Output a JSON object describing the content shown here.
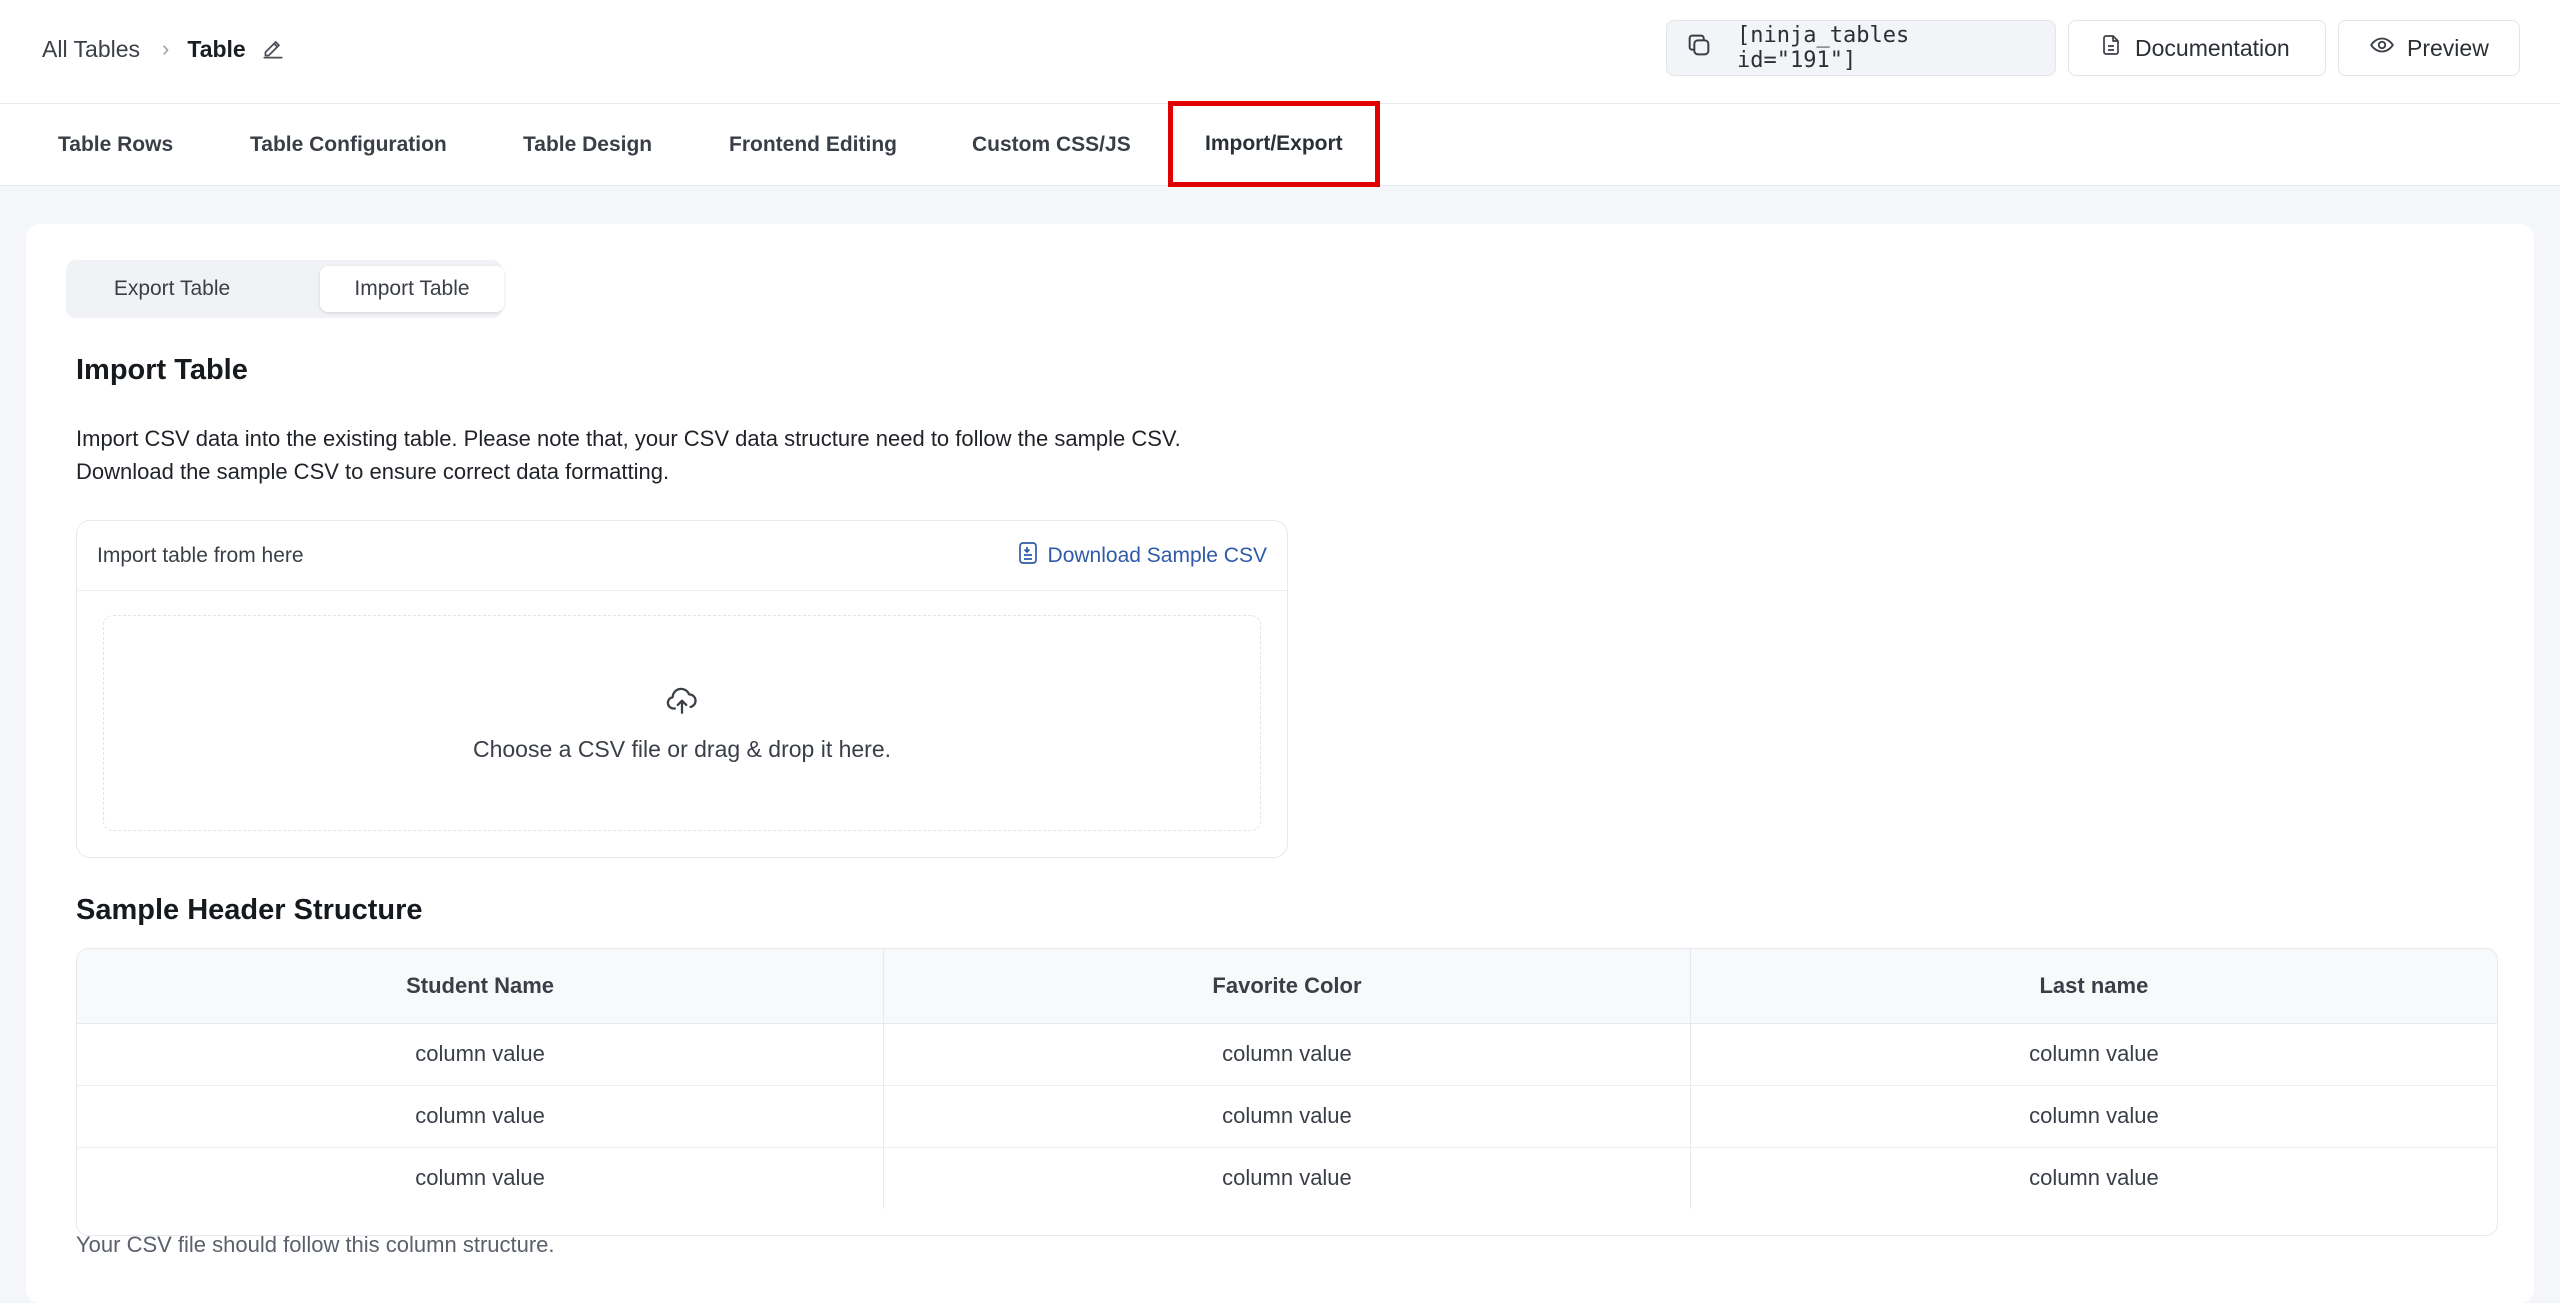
{
  "breadcrumb": {
    "root": "All Tables",
    "separator": "›",
    "current": "Table"
  },
  "top_actions": {
    "shortcode": "[ninja_tables id=\"191\"]",
    "documentation": "Documentation",
    "preview": "Preview"
  },
  "tabs": [
    {
      "label": "Table Rows"
    },
    {
      "label": "Table Configuration"
    },
    {
      "label": "Table Design"
    },
    {
      "label": "Frontend Editing"
    },
    {
      "label": "Custom CSS/JS"
    },
    {
      "label": "Import/Export",
      "active": true
    }
  ],
  "segmented": {
    "export": "Export Table",
    "import": "Import Table",
    "active": "Import Table"
  },
  "import": {
    "title": "Import Table",
    "description_line1": "Import CSV data into the existing table. Please note that, your CSV data structure need to follow the sample CSV.",
    "description_line2": "Download the sample CSV to ensure correct data formatting.",
    "box_label": "Import table from here",
    "download_link": "Download Sample CSV",
    "dropzone_text": "Choose a CSV file or drag & drop it here."
  },
  "sample": {
    "title": "Sample Header Structure",
    "headers": [
      "Student Name",
      "Favorite Color",
      "Last name"
    ],
    "rows": [
      [
        "column value",
        "column value",
        "column value"
      ],
      [
        "column value",
        "column value",
        "column value"
      ],
      [
        "column value",
        "column value",
        "column value"
      ]
    ],
    "footnote": "Your CSV file should follow this column structure."
  },
  "colors": {
    "highlight": "#e00000",
    "link": "#2f5aa8"
  },
  "icons": {
    "edit": "pencil-icon",
    "copy": "copy-icon",
    "documentation": "document-icon",
    "preview": "eye-icon",
    "download": "file-icon",
    "upload": "cloud-upload-icon"
  }
}
